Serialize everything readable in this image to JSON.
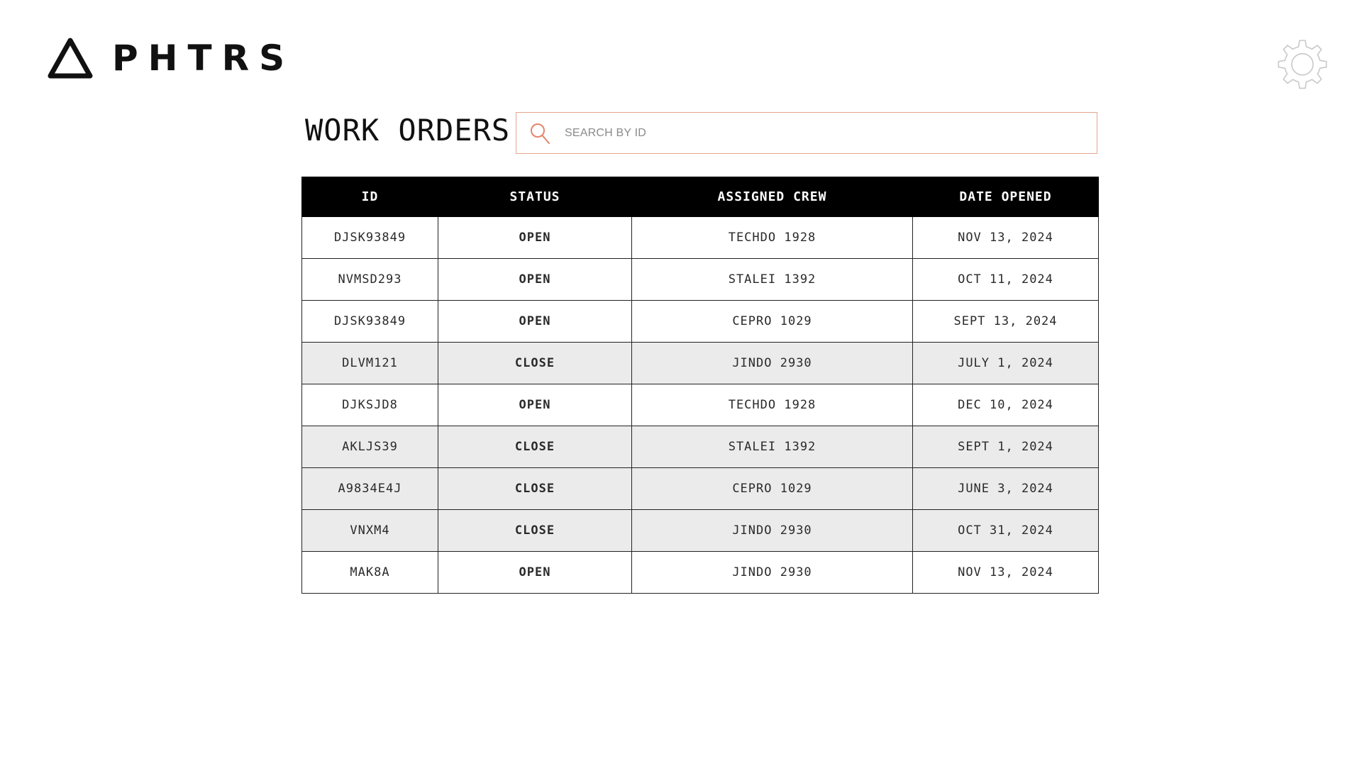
{
  "brand": {
    "name": "PHTRS"
  },
  "page": {
    "title": "WORK ORDERS"
  },
  "search": {
    "placeholder": "SEARCH BY ID",
    "value": ""
  },
  "colors": {
    "accent": "#e2856a",
    "header_bg": "#000000",
    "closed_row_bg": "#ebebeb",
    "search_border": "#e6a58d"
  },
  "icons": {
    "logo": "triangle-logo-icon",
    "settings": "gear-icon",
    "search": "search-icon"
  },
  "table": {
    "columns": [
      "ID",
      "STATUS",
      "ASSIGNED CREW",
      "DATE OPENED"
    ],
    "rows": [
      {
        "id": "DJSK93849",
        "status": "OPEN",
        "crew": "TECHDO 1928",
        "date": "NOV 13, 2024"
      },
      {
        "id": "NVMSD293",
        "status": "OPEN",
        "crew": "STALEI 1392",
        "date": "OCT 11, 2024"
      },
      {
        "id": "DJSK93849",
        "status": "OPEN",
        "crew": "CEPRO 1029",
        "date": "SEPT 13, 2024"
      },
      {
        "id": "DLVM121",
        "status": "CLOSE",
        "crew": "JINDO 2930",
        "date": "JULY 1, 2024"
      },
      {
        "id": "DJKSJD8",
        "status": "OPEN",
        "crew": "TECHDO 1928",
        "date": "DEC 10, 2024"
      },
      {
        "id": "AKLJS39",
        "status": "CLOSE",
        "crew": "STALEI 1392",
        "date": "SEPT 1, 2024"
      },
      {
        "id": "A9834E4J",
        "status": "CLOSE",
        "crew": "CEPRO 1029",
        "date": "JUNE 3, 2024"
      },
      {
        "id": "VNXM4",
        "status": "CLOSE",
        "crew": "JINDO 2930",
        "date": "OCT 31, 2024"
      },
      {
        "id": "MAK8A",
        "status": "OPEN",
        "crew": "JINDO 2930",
        "date": "NOV 13, 2024"
      }
    ]
  }
}
